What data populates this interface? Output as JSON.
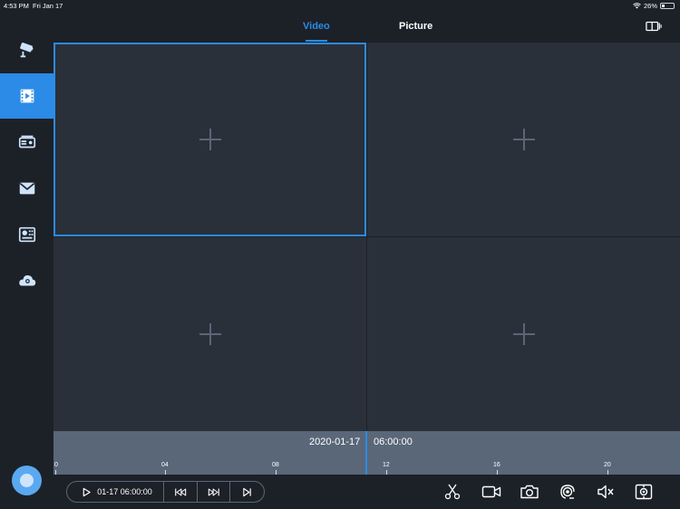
{
  "status_bar": {
    "time": "4:53 PM",
    "date": "Fri Jan 17",
    "battery": "26%",
    "battery_level": 0.26
  },
  "sidebar": {
    "items": [
      {
        "icon": "cctv-camera-icon",
        "active": false
      },
      {
        "icon": "video-playback-icon",
        "active": true
      },
      {
        "icon": "dvr-device-icon",
        "active": false
      },
      {
        "icon": "mail-icon",
        "active": false
      },
      {
        "icon": "control-panel-icon",
        "active": false
      },
      {
        "icon": "cloud-icon",
        "active": false
      }
    ],
    "avatar_icon": "user-avatar-icon"
  },
  "header": {
    "tabs": [
      {
        "label": "Video",
        "active": true
      },
      {
        "label": "Picture",
        "active": false
      }
    ],
    "layout_icon": "split-screen-icon"
  },
  "grid": {
    "cells": [
      {
        "icon": "add-icon",
        "selected": true
      },
      {
        "icon": "add-icon",
        "selected": false
      },
      {
        "icon": "add-icon",
        "selected": false
      },
      {
        "icon": "add-icon",
        "selected": false
      }
    ]
  },
  "timeline": {
    "date": "2020-01-17",
    "time": "06:00:00",
    "ticks": [
      "0",
      "04",
      "08",
      "12",
      "16",
      "20"
    ]
  },
  "controls": {
    "playback_time": "01-17 06:00:00",
    "buttons": [
      "play-icon",
      "rewind-icon",
      "fast-forward-icon",
      "next-frame-icon"
    ],
    "tools": [
      "scissors-icon",
      "record-icon",
      "snapshot-icon",
      "talk-icon",
      "mute-icon",
      "fullscreen-capture-icon"
    ]
  },
  "colors": {
    "accent": "#2b8be6",
    "background": "#1c2128",
    "cell": "#2a3039",
    "timeline": "#596779"
  }
}
